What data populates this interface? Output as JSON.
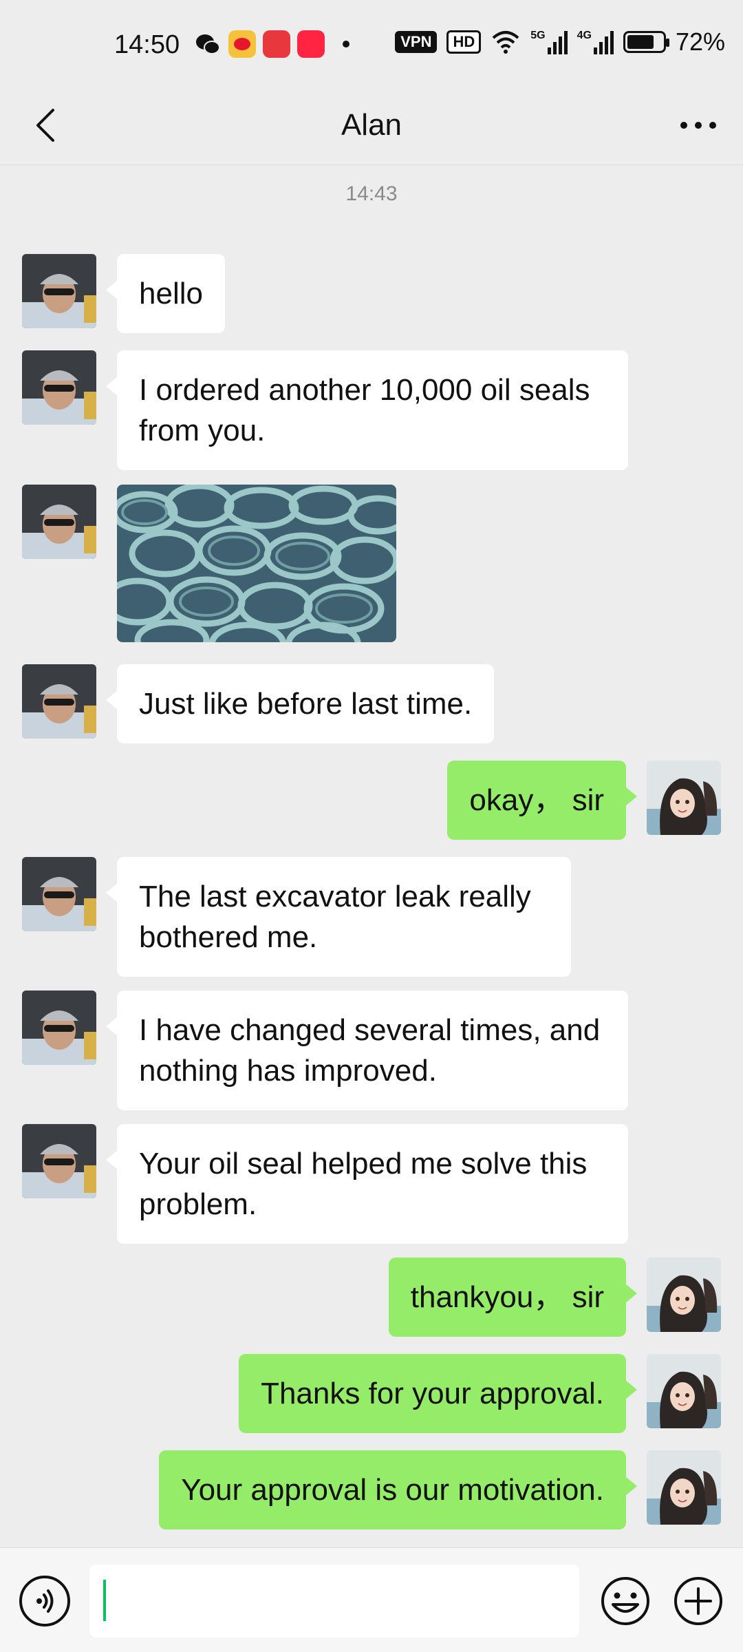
{
  "status": {
    "time": "14:50",
    "vpn": "VPN",
    "hd": "HD",
    "net5g": "5G",
    "net4g": "4G",
    "battery": "72%",
    "app_icons": [
      "wechat-icon",
      "weibo-icon",
      "app-icon",
      "xiaohongshu-icon"
    ]
  },
  "nav": {
    "title": "Alan"
  },
  "chat": {
    "timestamp": "14:43",
    "messages": [
      {
        "from": "contact",
        "text": "hello"
      },
      {
        "from": "contact",
        "text": "I ordered another 10,000 oil seals from you."
      },
      {
        "from": "contact",
        "type": "image",
        "image_name": "oil-seals-photo"
      },
      {
        "from": "contact",
        "text": "Just like before last time."
      },
      {
        "from": "me",
        "text": "okay， sir"
      },
      {
        "from": "contact",
        "text": "The last excavator leak really bothered me."
      },
      {
        "from": "contact",
        "text": "I have changed several times, and nothing has improved."
      },
      {
        "from": "contact",
        "text": "Your oil seal helped me solve this problem."
      },
      {
        "from": "me",
        "text": "thankyou， sir"
      },
      {
        "from": "me",
        "text": "Thanks for your approval."
      },
      {
        "from": "me",
        "text": "Your approval is our motivation."
      }
    ]
  },
  "input": {
    "value": ""
  },
  "colors": {
    "background": "#ededed",
    "outgoing_bubble": "#95ec69",
    "incoming_bubble": "#ffffff",
    "caret": "#07c160"
  }
}
